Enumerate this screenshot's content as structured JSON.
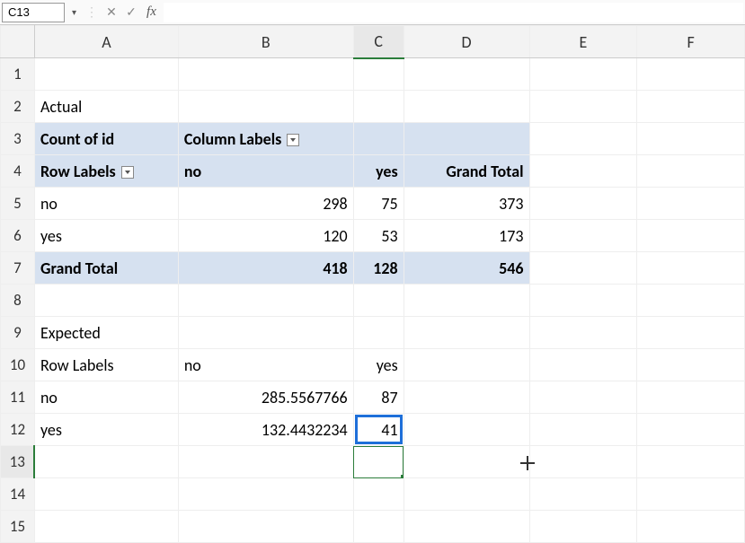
{
  "nameBox": "C13",
  "formulaInput": "",
  "columns": [
    "A",
    "B",
    "C",
    "D",
    "E",
    "F"
  ],
  "rows": [
    "1",
    "2",
    "3",
    "4",
    "5",
    "6",
    "7",
    "8",
    "9",
    "10",
    "11",
    "12",
    "13",
    "14",
    "15"
  ],
  "cells": {
    "A2": "Actual",
    "A3": "Count of id",
    "B3": "Column Labels",
    "A4": "Row Labels",
    "B4": "no",
    "C4": "yes",
    "D4": "Grand Total",
    "A5": "no",
    "B5": "298",
    "C5": "75",
    "D5": "373",
    "A6": "yes",
    "B6": "120",
    "C6": "53",
    "D6": "173",
    "A7": "Grand Total",
    "B7": "418",
    "C7": "128",
    "D7": "546",
    "A9": "Expected",
    "A10": "Row Labels",
    "B10": "no",
    "C10": "yes",
    "A11": "no",
    "B11": "285.5567766",
    "C11": "87",
    "A12": "yes",
    "B12": "132.4432234",
    "C12": "41"
  }
}
